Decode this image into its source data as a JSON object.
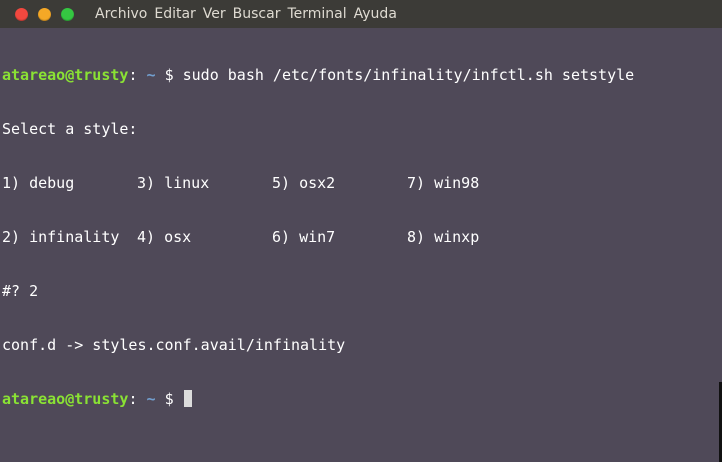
{
  "window": {
    "controls": {
      "close_color": "#f1483f",
      "minimize_color": "#f5a826",
      "maximize_color": "#35c742"
    }
  },
  "menu": {
    "items": [
      "Archivo",
      "Editar",
      "Ver",
      "Buscar",
      "Terminal",
      "Ayuda"
    ]
  },
  "colors": {
    "background": "#4f4958",
    "titlebar": "#3c3b37",
    "prompt_user": "#8ae234",
    "prompt_path": "#729fcf",
    "text": "#ffffff",
    "cursor": "#dcdcdc"
  },
  "terminal": {
    "prompt": {
      "user_host": "atareao@trusty",
      "colon": ":",
      "path": "~",
      "sign": "$"
    },
    "command": "sudo bash /etc/fonts/infinality/infctl.sh setstyle",
    "select_prompt": "Select a style:",
    "options": [
      [
        "1) debug",
        "3) linux",
        "5) osx2",
        "7) win98"
      ],
      [
        "2) infinality",
        "4) osx",
        "6) win7",
        "8) winxp"
      ]
    ],
    "answer_line": "#? 2",
    "result_line": "conf.d -> styles.conf.avail/infinality"
  }
}
